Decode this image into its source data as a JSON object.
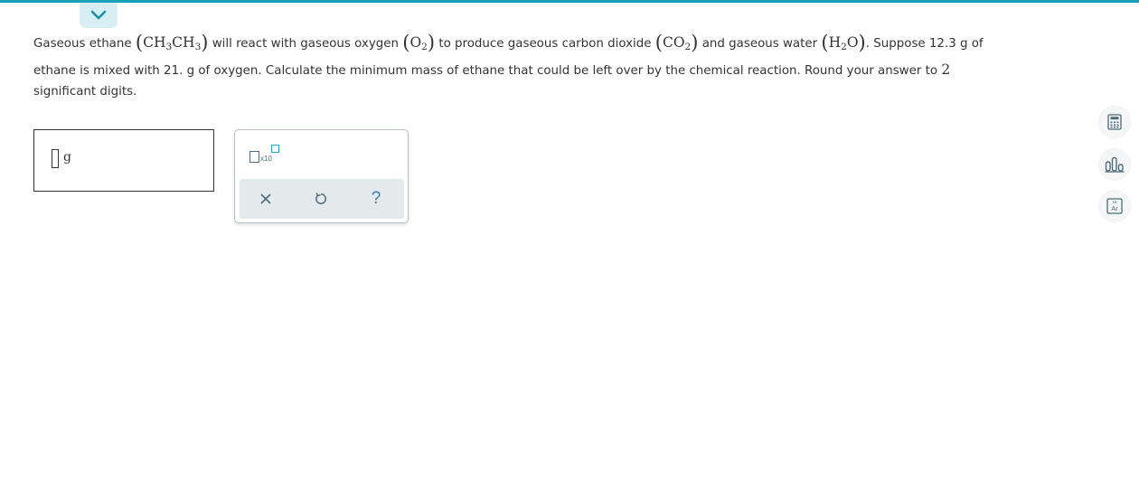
{
  "question": {
    "line1": {
      "t1": "Gaseous ethane",
      "ethane_a": "CH",
      "ethane_a_sub": "3",
      "ethane_b": "CH",
      "ethane_b_sub": "3",
      "t2": "will react with gaseous oxygen",
      "oxygen": "O",
      "oxygen_sub": "2",
      "t3": "to produce gaseous carbon dioxide",
      "co2": "CO",
      "co2_sub": "2",
      "t4": "and gaseous water",
      "water_h": "H",
      "water_h_sub": "2",
      "water_o": "O",
      "t5": ". Suppose 12.3 g of"
    },
    "line2": {
      "text": "ethane is mixed with 21. g of oxygen. Calculate the minimum mass of ethane that could be left over by the chemical reaction. Round your answer to",
      "digits": "2"
    },
    "line3": "significant digits."
  },
  "answer": {
    "unit": "g",
    "value": ""
  },
  "palette": {
    "x10_label": "x10",
    "clear_icon": "close-icon",
    "undo_icon": "undo-icon",
    "help_label": "?"
  },
  "side_tools": {
    "calculator_icon": "calculator-icon",
    "data_icon": "bar-chart-icon",
    "periodic_table_label": "Ar"
  },
  "colors": {
    "accent": "#16a1b8",
    "help": "#3a7cc4"
  }
}
